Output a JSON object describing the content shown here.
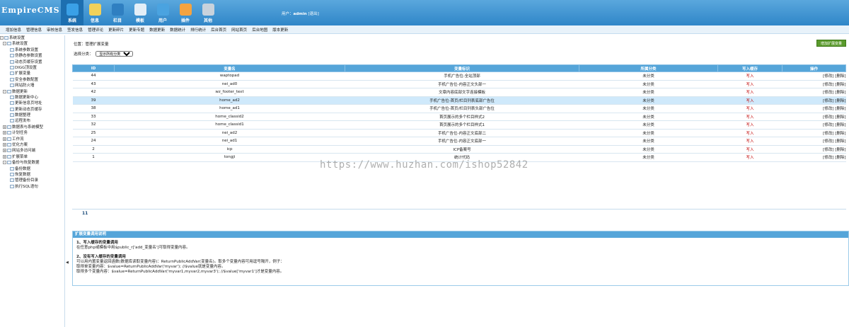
{
  "header": {
    "logo": "EmpireCMS",
    "nav": [
      {
        "label": "系统",
        "icon": "system-icon",
        "color": "#3aa0e6"
      },
      {
        "label": "信息",
        "icon": "edit-icon",
        "color": "#f1d15a"
      },
      {
        "label": "栏目",
        "icon": "folder-icon",
        "color": "#2f7fc1"
      },
      {
        "label": "模板",
        "icon": "template-icon",
        "color": "#e3eef7"
      },
      {
        "label": "用户",
        "icon": "user-icon",
        "color": "#4aa3e0"
      },
      {
        "label": "插件",
        "icon": "plugin-icon",
        "color": "#f4a340"
      },
      {
        "label": "其他",
        "icon": "gear-icon",
        "color": "#c8d2dc"
      }
    ],
    "user_prefix": "用户：",
    "username": "admin",
    "logout": "[退出]"
  },
  "subnav": [
    "增加信息",
    "管理信息",
    "审核信息",
    "签发信息",
    "管理评论",
    "更新碎片",
    "更新专题",
    "数据更新",
    "数据统计",
    "排行统计",
    "后台首页",
    "网站首页",
    "后台地图",
    "版本更新"
  ],
  "sidebar": [
    {
      "label": "系统设置",
      "level": 0,
      "pm": "-"
    },
    {
      "label": "系统设置",
      "level": 1,
      "pm": "-"
    },
    {
      "label": "系统参数设置",
      "level": 2
    },
    {
      "label": "伪静态参数设置",
      "level": 2
    },
    {
      "label": "动态页缓存设置",
      "level": 2
    },
    {
      "label": "DIGG顶设置",
      "level": 2
    },
    {
      "label": "扩展变量",
      "level": 2
    },
    {
      "label": "安全参数配置",
      "level": 2
    },
    {
      "label": "网站防火墙",
      "level": 2
    },
    {
      "label": "数据更新",
      "level": 1,
      "pm": "-"
    },
    {
      "label": "数据更新中心",
      "level": 2
    },
    {
      "label": "更新信息页地址",
      "level": 2
    },
    {
      "label": "更新动态页缓存",
      "level": 2
    },
    {
      "label": "数据整理",
      "level": 2
    },
    {
      "label": "远程发布",
      "level": 2
    },
    {
      "label": "数据表与系统模型",
      "level": 1,
      "pm": "+"
    },
    {
      "label": "计划任务",
      "level": 1,
      "pm": "+"
    },
    {
      "label": "工作流",
      "level": 1,
      "pm": "+"
    },
    {
      "label": "优化方案",
      "level": 1,
      "pm": "+"
    },
    {
      "label": "网站多访问端",
      "level": 1,
      "pm": "+"
    },
    {
      "label": "扩展菜单",
      "level": 1,
      "pm": "+"
    },
    {
      "label": "备份与恢复数据",
      "level": 1,
      "pm": "-"
    },
    {
      "label": "备份数据",
      "level": 2
    },
    {
      "label": "恢复数据",
      "level": 2
    },
    {
      "label": "管理备份目录",
      "level": 2
    },
    {
      "label": "执行SQL语句",
      "level": 2
    }
  ],
  "main": {
    "breadcrumb": "位置：管理扩展变量",
    "add_button": "增加扩展变量",
    "filter_label": "选择分类：",
    "filter_value": "显示所有分类",
    "columns": [
      "ID",
      "变量名",
      "变量标识",
      "所属分类",
      "写入缓存",
      "操作"
    ],
    "rows": [
      {
        "id": "44",
        "name": "waptopad",
        "desc": "手机广告位-全站顶部",
        "cat": "未分类",
        "cache": "写入",
        "ops": "[修改] [删除]"
      },
      {
        "id": "43",
        "name": "nei_ad0",
        "desc": "手机广告位-内容正文头部一",
        "cat": "未分类",
        "cache": "写入",
        "ops": "[修改] [删除]"
      },
      {
        "id": "42",
        "name": "wz_footer_text",
        "desc": "文章内容底部文字连接模板",
        "cat": "未分类",
        "cache": "写入",
        "ops": "[修改] [删除]"
      },
      {
        "id": "39",
        "name": "home_ad2",
        "desc": "手机广告位-首页/栏目列表底部广告位",
        "cat": "未分类",
        "cache": "写入",
        "ops": "[修改] [删除]",
        "hl": true
      },
      {
        "id": "38",
        "name": "home_ad1",
        "desc": "手机广告位-首页/栏目列表头部广告位",
        "cat": "未分类",
        "cache": "写入",
        "ops": "[修改] [删除]"
      },
      {
        "id": "33",
        "name": "home_classid2",
        "desc": "首页展示的多个栏目样式2",
        "cat": "未分类",
        "cache": "写入",
        "ops": "[修改] [删除]"
      },
      {
        "id": "32",
        "name": "home_classid1",
        "desc": "首页展示的多个栏目样式1",
        "cat": "未分类",
        "cache": "写入",
        "ops": "[修改] [删除]"
      },
      {
        "id": "25",
        "name": "nei_ad2",
        "desc": "手机广告位-内容正文底部二",
        "cat": "未分类",
        "cache": "写入",
        "ops": "[修改] [删除]"
      },
      {
        "id": "24",
        "name": "nei_ad1",
        "desc": "手机广告位-内容正文底部一",
        "cat": "未分类",
        "cache": "写入",
        "ops": "[修改] [删除]"
      },
      {
        "id": "2",
        "name": "icp",
        "desc": "ICP备案号",
        "cat": "未分类",
        "cache": "写入",
        "ops": "[修改] [删除]"
      },
      {
        "id": "1",
        "name": "tongji",
        "desc": "统计代码",
        "cat": "未分类",
        "cache": "写入",
        "ops": "[修改] [删除]"
      }
    ],
    "pager": "11",
    "help": {
      "title": "扩展变量调用说明",
      "h1": "1、写入缓存的变量调用",
      "p1": "在任意php或模板中用$public_r['add_变量名']可取得变量内容。",
      "h2": "2、没有写入缓存的变量调用",
      "p2": "可以用内置变量返回函数(数据库读取变量内容)：ReturnPublicAddVar(变量名)。取多个变量内容可用逗号隔开，例子：",
      "p3": "取得单变量内容：$value=ReturnPublicAddVar('myvar'); //$value就是变量内容。",
      "p4": "取得多个变量内容：$value=ReturnPublicAddVar('myvar1,myvar2,myvar3'); //$value['myvar1']才是变量内容。"
    }
  },
  "watermark": "https://www.huzhan.com/ishop52842"
}
